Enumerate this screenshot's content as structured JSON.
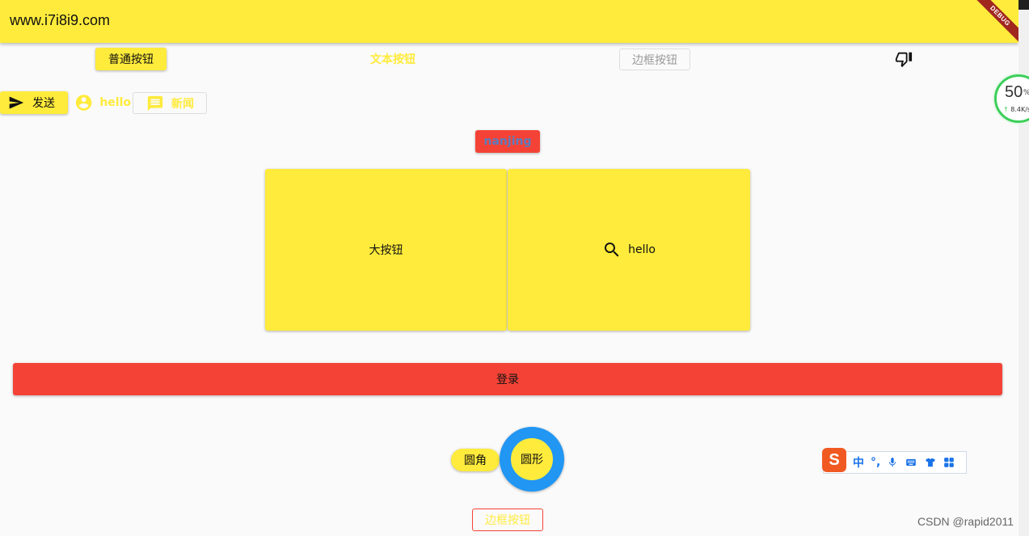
{
  "appbar": {
    "title": "www.i7i8i9.com",
    "debug_label": "DEBUG"
  },
  "row1": {
    "raised_button": "普通按钮",
    "text_button": "文本按钮",
    "outline_button": "边框按钮",
    "icon_button_icon": "thumb-down-icon"
  },
  "row2": {
    "send_button": "发送",
    "send_icon": "send-icon",
    "hello_button": "hello",
    "hello_icon": "account-circle-icon",
    "news_button": "新闻",
    "news_icon": "message-icon"
  },
  "nanjing_button": "nanjing",
  "big_buttons": {
    "left": "大按钮",
    "right": "hello",
    "right_icon": "search-icon"
  },
  "login_button": "登录",
  "shapes": {
    "rounded_button": "圆角",
    "circle_button": "圆形"
  },
  "bottom_outline_button": "边框按钮",
  "overlay": {
    "speed_value": "50",
    "speed_unit": "%",
    "speed_rate": "8.4K/s"
  },
  "ime": {
    "logo": "S",
    "items": [
      "中",
      "°,",
      "mic-icon",
      "keyboard-icon",
      "shirt-icon",
      "grid-icon"
    ],
    "lang_label": "中",
    "punct_label": "°,"
  },
  "watermark": "CSDN @rapid2011",
  "colors": {
    "appbar": "#ffeb3b",
    "accent_yellow": "#ffeb3b",
    "red": "#f44336",
    "blue_ring": "#2196f3",
    "nanjing_text": "#5c7cbf"
  }
}
